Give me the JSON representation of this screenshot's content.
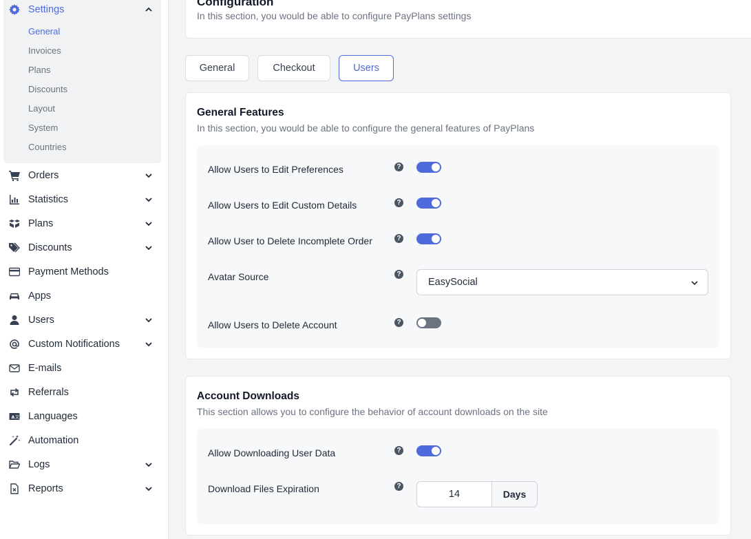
{
  "sidebar": {
    "settings": {
      "label": "Settings",
      "icon": "gear-icon",
      "sub_items": [
        "General",
        "Invoices",
        "Plans",
        "Discounts",
        "Layout",
        "System",
        "Countries"
      ],
      "active_sub": "General"
    },
    "items": [
      {
        "label": "Orders",
        "icon": "cart-icon",
        "has_children": true
      },
      {
        "label": "Statistics",
        "icon": "bar-chart-icon",
        "has_children": true
      },
      {
        "label": "Plans",
        "icon": "boxes-icon",
        "has_children": true
      },
      {
        "label": "Discounts",
        "icon": "tags-icon",
        "has_children": true
      },
      {
        "label": "Payment Methods",
        "icon": "credit-card-icon",
        "has_children": false
      },
      {
        "label": "Apps",
        "icon": "car-icon",
        "has_children": false
      },
      {
        "label": "Users",
        "icon": "user-icon",
        "has_children": true
      },
      {
        "label": "Custom Notifications",
        "icon": "at-icon",
        "has_children": true
      },
      {
        "label": "E-mails",
        "icon": "envelope-icon",
        "has_children": false
      },
      {
        "label": "Referrals",
        "icon": "retweet-icon",
        "has_children": false
      },
      {
        "label": "Languages",
        "icon": "language-icon",
        "has_children": false
      },
      {
        "label": "Automation",
        "icon": "magic-wand-icon",
        "has_children": false
      },
      {
        "label": "Logs",
        "icon": "folder-open-icon",
        "has_children": true
      },
      {
        "label": "Reports",
        "icon": "file-report-icon",
        "has_children": true
      }
    ]
  },
  "header": {
    "title": "Configuration",
    "subtitle": "In this section, you would be able to configure PayPlans settings"
  },
  "tabs": [
    {
      "label": "General",
      "active": false
    },
    {
      "label": "Checkout",
      "active": false
    },
    {
      "label": "Users",
      "active": true
    }
  ],
  "general_features": {
    "title": "General Features",
    "subtitle": "In this section, you would be able to configure the general features of PayPlans",
    "rows": [
      {
        "label": "Allow Users to Edit Preferences",
        "type": "toggle",
        "enabled": true
      },
      {
        "label": "Allow Users to Edit Custom Details",
        "type": "toggle",
        "enabled": true
      },
      {
        "label": "Allow User to Delete Incomplete Order",
        "type": "toggle",
        "enabled": true
      },
      {
        "label": "Avatar Source",
        "type": "select",
        "value": "EasySocial"
      },
      {
        "label": "Allow Users to Delete Account",
        "type": "toggle",
        "enabled": false
      }
    ]
  },
  "account_downloads": {
    "title": "Account Downloads",
    "subtitle": "This section allows you to configure the behavior of account downloads on the site",
    "rows": [
      {
        "label": "Allow Downloading User Data",
        "type": "toggle",
        "enabled": true
      },
      {
        "label": "Download Files Expiration",
        "type": "number",
        "value": "14",
        "unit": "Days"
      }
    ]
  },
  "help_glyph": "?",
  "colors": {
    "accent": "#4f6bdb",
    "toggle_off": "#6b7280",
    "panel_bg": "#f7f8fa"
  }
}
